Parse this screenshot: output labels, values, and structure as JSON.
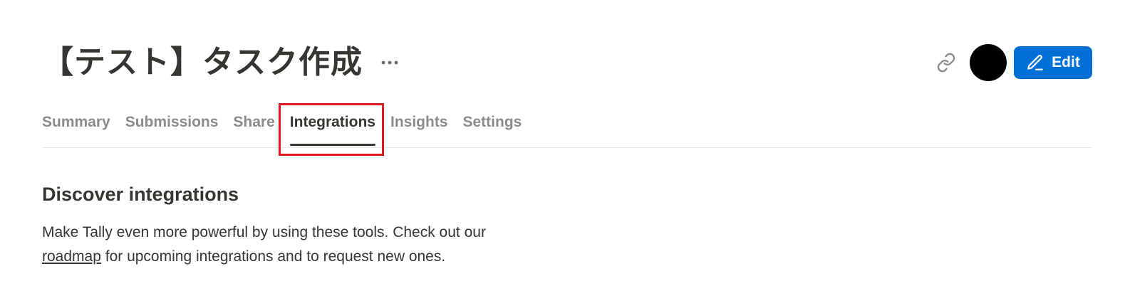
{
  "header": {
    "title": "【テスト】タスク作成",
    "more_icon": "ellipsis-icon",
    "link_icon": "link-icon",
    "edit_label": "Edit",
    "edit_icon": "pencil-icon",
    "accent_color": "#0070d7",
    "avatar_color": "#000000"
  },
  "tabs": [
    {
      "label": "Summary",
      "active": false
    },
    {
      "label": "Submissions",
      "active": false
    },
    {
      "label": "Share",
      "active": false
    },
    {
      "label": "Integrations",
      "active": true
    },
    {
      "label": "Insights",
      "active": false
    },
    {
      "label": "Settings",
      "active": false
    }
  ],
  "highlight_color": "#e0191d",
  "content": {
    "title": "Discover integrations",
    "desc_part1": "Make Tally even more powerful by using these tools. Check out our",
    "desc_link": "roadmap",
    "desc_part2": "for upcoming integrations and to request new ones."
  }
}
